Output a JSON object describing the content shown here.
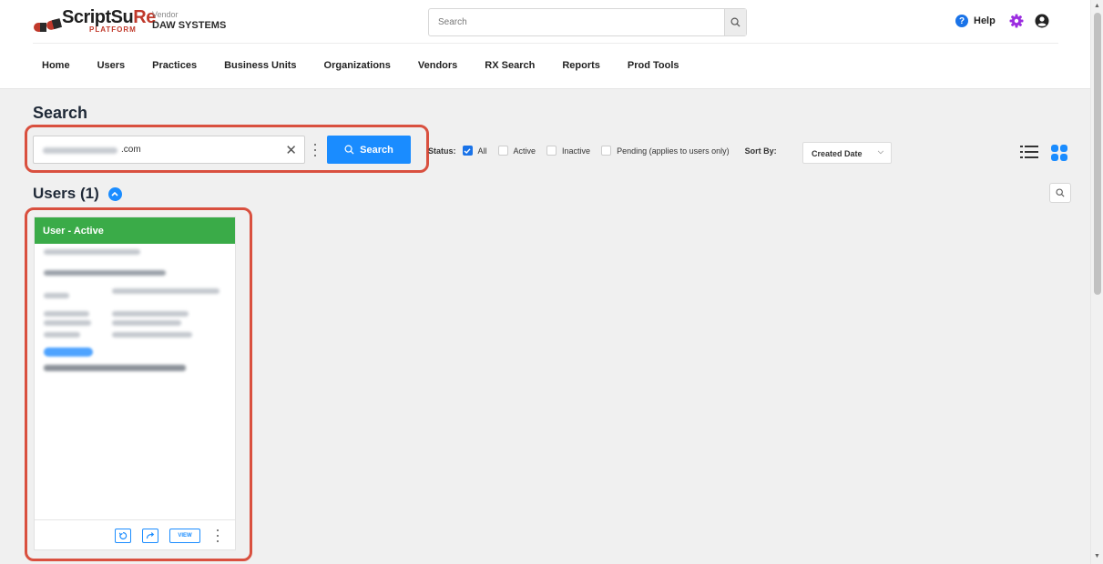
{
  "header": {
    "logo_text": "ScriptSu",
    "logo_rx": "Re",
    "logo_sub": "PLATFORM",
    "vendor_label": "Vendor",
    "vendor_name": "DAW SYSTEMS",
    "search_placeholder": "Search",
    "help_label": "Help",
    "accent_color": "#1a73e8",
    "gear_color": "#9b2de0"
  },
  "nav": {
    "items": [
      {
        "label": "Home"
      },
      {
        "label": "Users"
      },
      {
        "label": "Practices"
      },
      {
        "label": "Business Units"
      },
      {
        "label": "Organizations"
      },
      {
        "label": "Vendors"
      },
      {
        "label": "RX Search"
      },
      {
        "label": "Reports"
      },
      {
        "label": "Prod Tools"
      }
    ]
  },
  "search": {
    "title": "Search",
    "input_value_suffix": ".com",
    "button_label": "Search",
    "status_label": "Status:",
    "filters": [
      {
        "label": "All",
        "checked": true
      },
      {
        "label": "Active",
        "checked": false
      },
      {
        "label": "Inactive",
        "checked": false
      },
      {
        "label": "Pending (applies to users only)",
        "checked": false
      }
    ],
    "sort_label": "Sort By:",
    "sort_value": "Created Date"
  },
  "results": {
    "heading": "Users (1)",
    "card": {
      "header": "User - Active",
      "header_color": "#3aab48",
      "view_label": "VIEW"
    }
  }
}
